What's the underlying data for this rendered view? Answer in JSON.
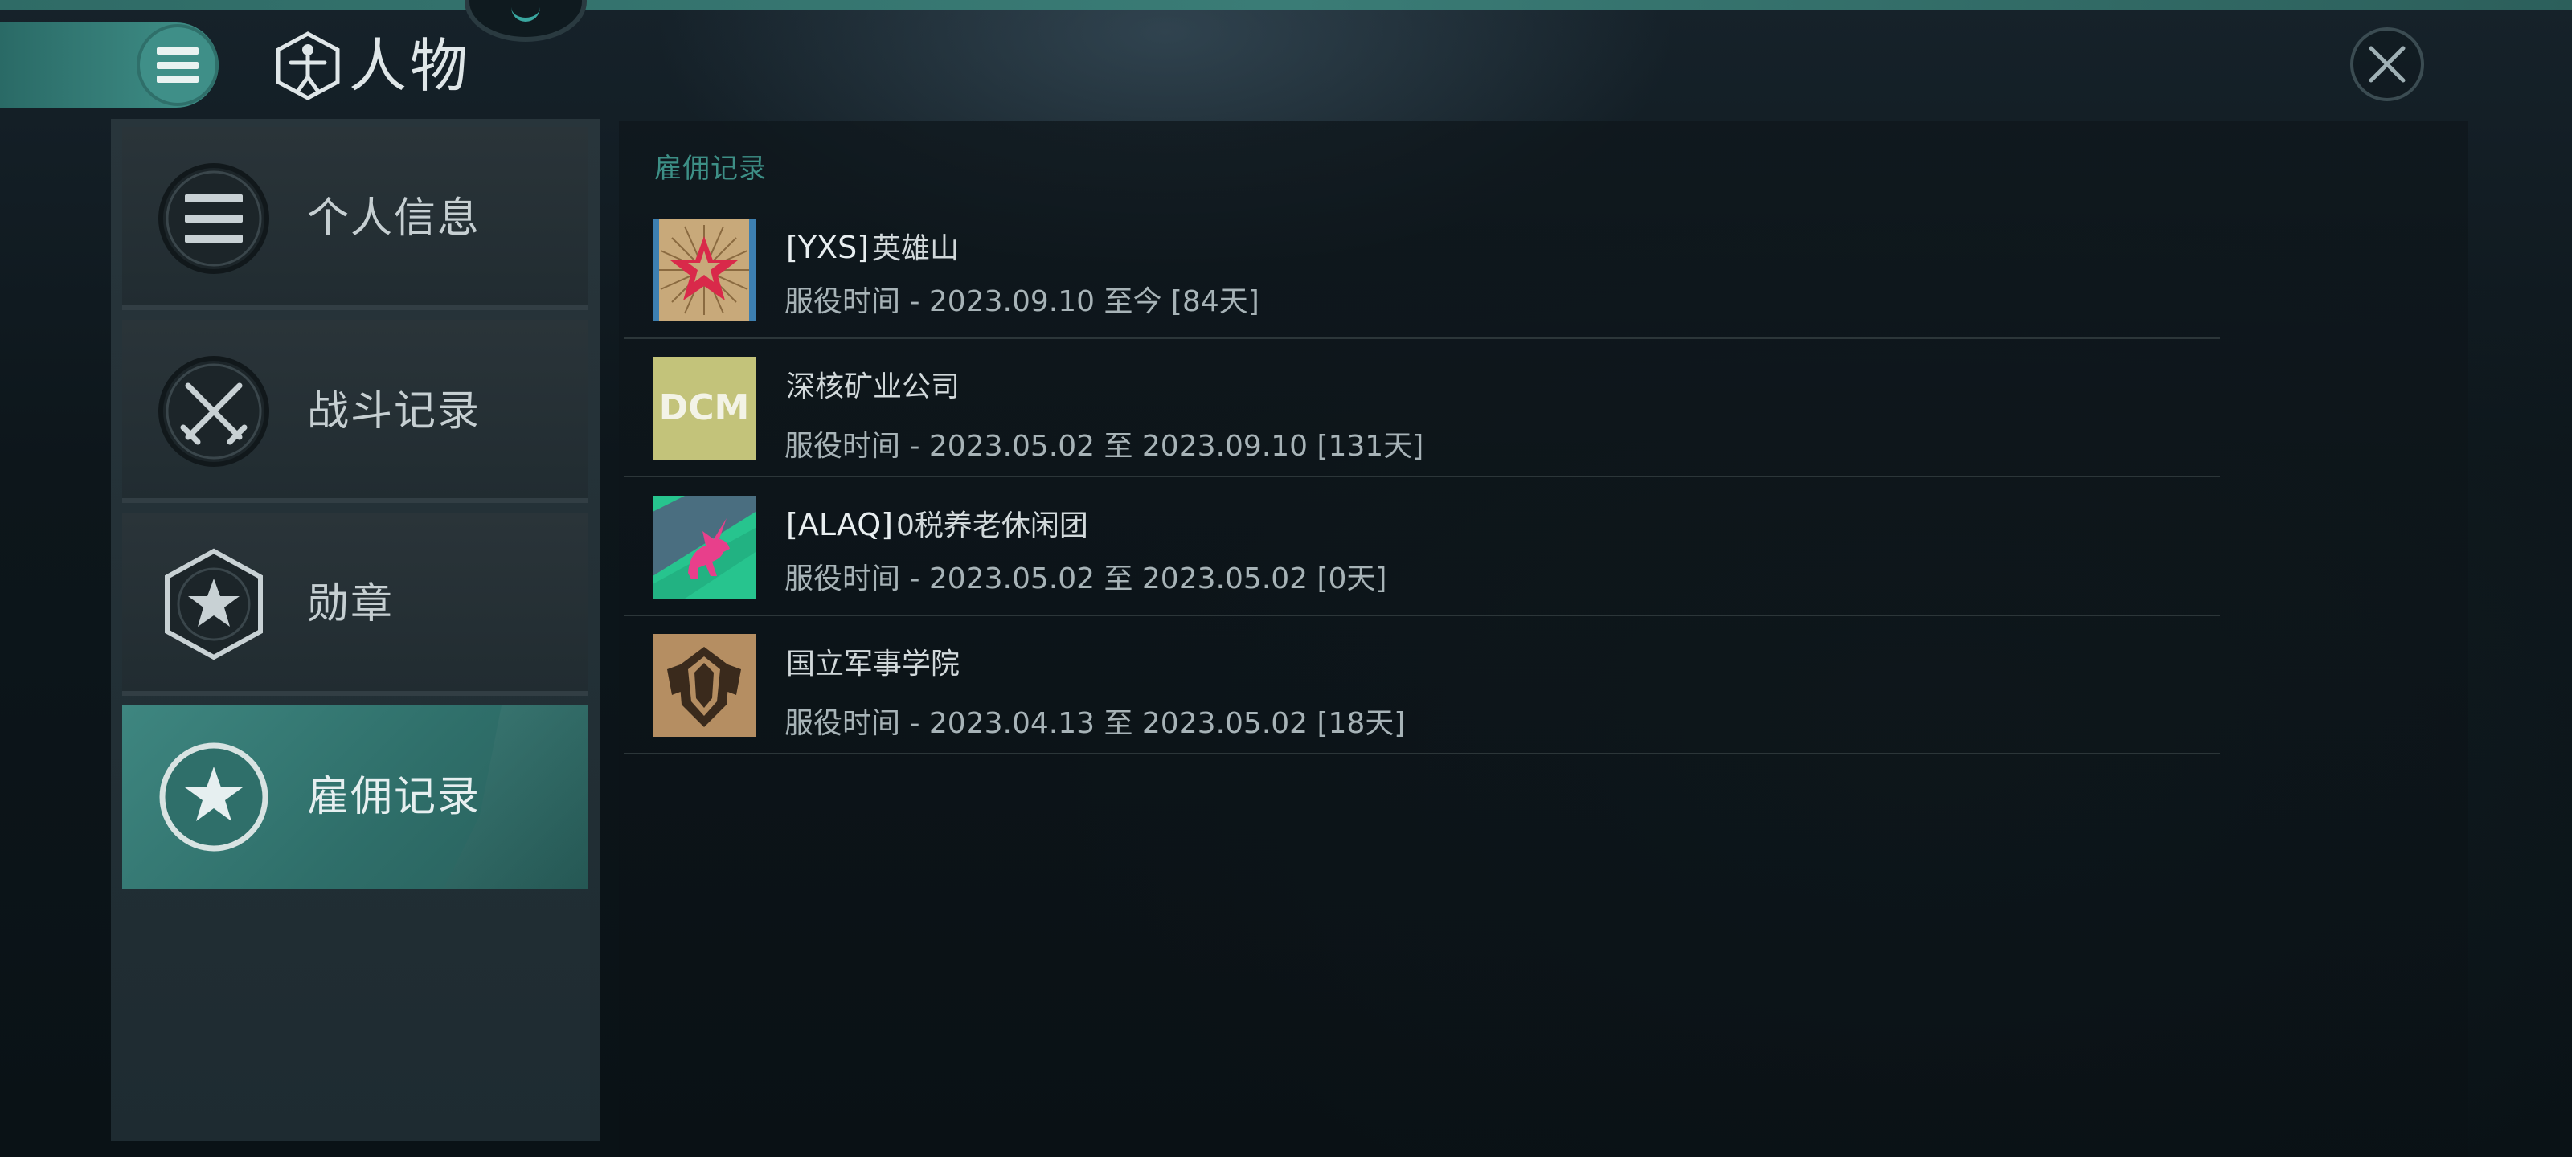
{
  "header": {
    "title": "人物",
    "menu_icon": "menu-icon",
    "title_icon": "vitruvian-hex-icon",
    "close_icon": "close-icon"
  },
  "sidebar": {
    "items": [
      {
        "label": "个人信息",
        "icon": "list-icon",
        "active": false
      },
      {
        "label": "战斗记录",
        "icon": "crossed-swords-icon",
        "active": false
      },
      {
        "label": "勋章",
        "icon": "star-hexagon-icon",
        "active": false
      },
      {
        "label": "雇佣记录",
        "icon": "star-circle-icon",
        "active": true
      }
    ]
  },
  "main": {
    "section_title": "雇佣记录",
    "records": [
      {
        "tag": "[YXS]",
        "name": "英雄山",
        "time": "服役时间 - 2023.09.10 至今 [84天]",
        "logo": "red-star-burst-logo"
      },
      {
        "tag": "",
        "name": "深核矿业公司",
        "time": "服役时间 - 2023.05.02 至 2023.09.10 [131天]",
        "logo": "dcm-logo",
        "logo_text": "DCM"
      },
      {
        "tag": "[ALAQ]",
        "name": "0税养老休闲团",
        "time": "服役时间 - 2023.05.02 至 2023.05.02 [0天]",
        "logo": "pink-unicorn-logo"
      },
      {
        "tag": "",
        "name": "国立军事学院",
        "time": "服役时间 - 2023.04.13 至 2023.05.02 [18天]",
        "logo": "military-academy-crest-logo"
      }
    ]
  },
  "colors": {
    "accent": "#3d8f86",
    "active_nav": "#3e8680",
    "background": "#0d161b"
  }
}
